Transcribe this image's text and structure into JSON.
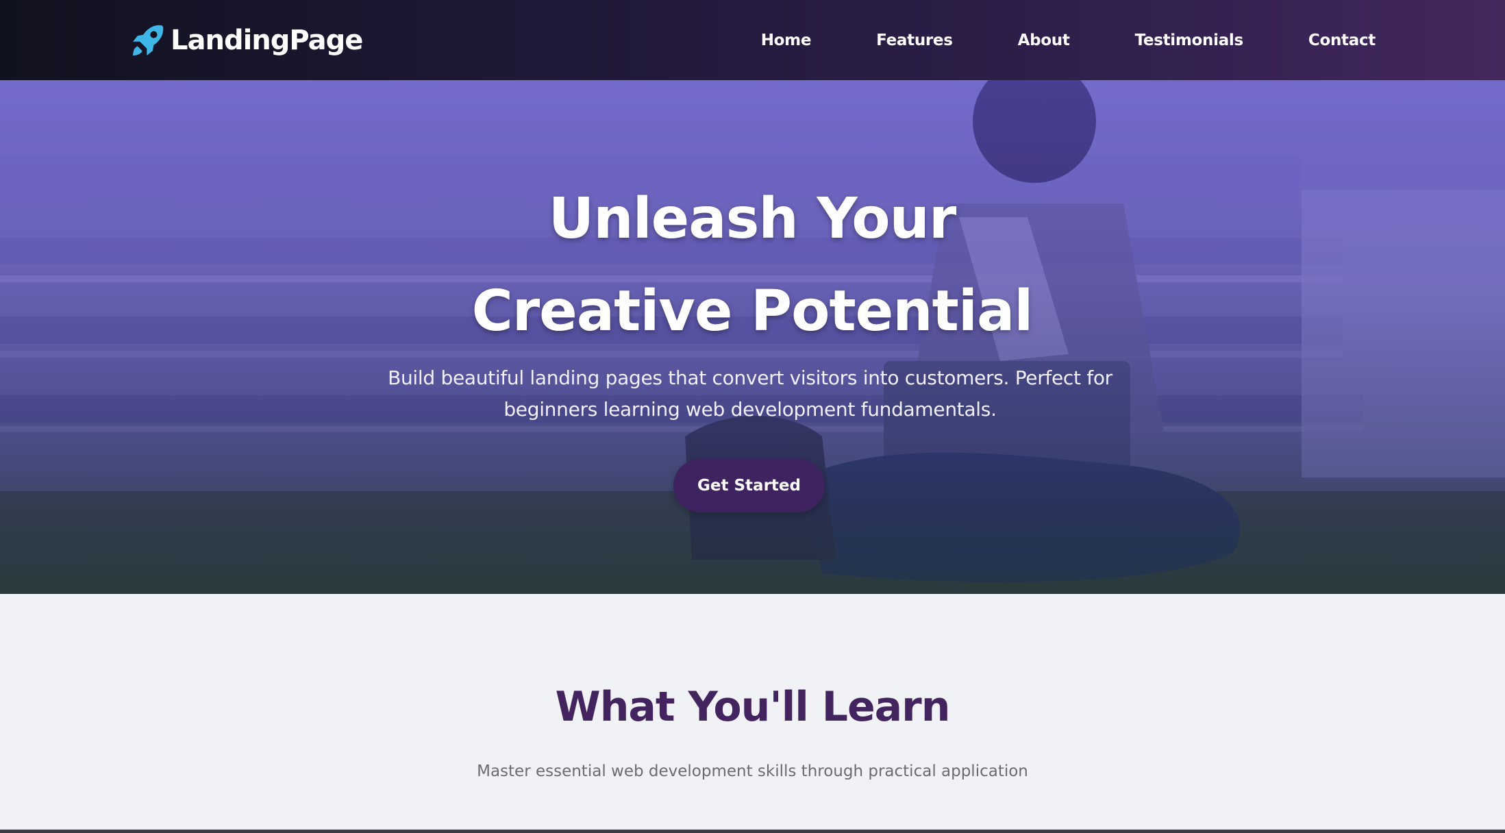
{
  "brand": {
    "name": "LandingPage",
    "icon": "rocket-icon",
    "icon_color": "#3fb6e8"
  },
  "nav": {
    "items": [
      {
        "label": "Home"
      },
      {
        "label": "Features"
      },
      {
        "label": "About"
      },
      {
        "label": "Testimonials"
      },
      {
        "label": "Contact"
      }
    ]
  },
  "hero": {
    "title": "Unleash Your Creative Potential",
    "subtitle": "Build beautiful landing pages that convert visitors into customers. Perfect for beginners learning web development fundamentals.",
    "cta_label": "Get Started"
  },
  "features": {
    "title": "What You'll Learn",
    "subtitle": "Master essential web development skills through practical application"
  },
  "colors": {
    "brand_purple": "#43245f",
    "cta_background": "#3f2260",
    "hero_tint": "#6254cd"
  }
}
